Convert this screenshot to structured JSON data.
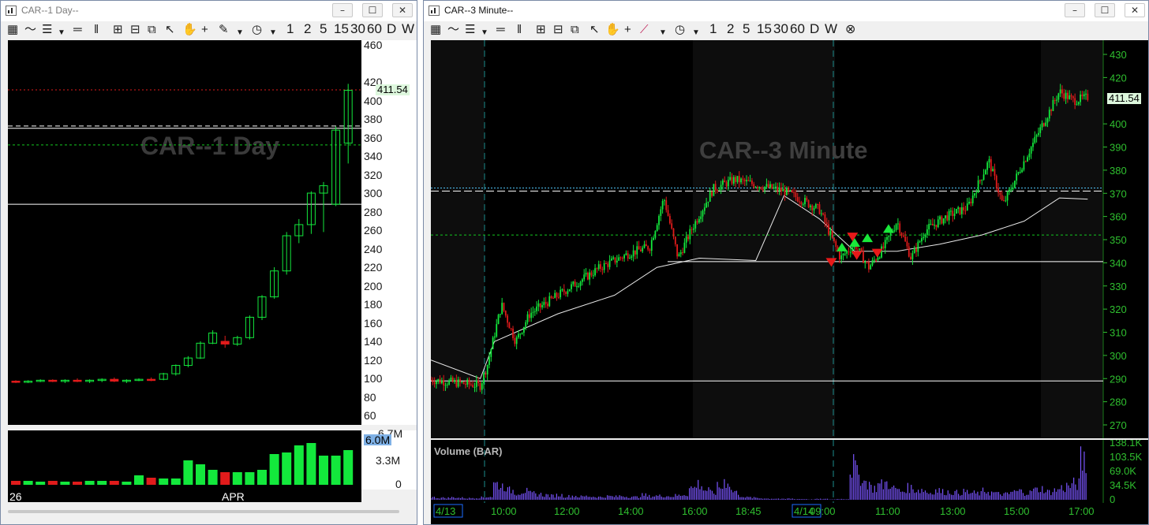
{
  "left_window": {
    "title": "CAR--1 Day--",
    "watermark": "CAR--1 Day",
    "last_price": "411.54",
    "volume_tag": "6.0M",
    "price_ticks": [
      "460",
      "420",
      "400",
      "380",
      "360",
      "340",
      "320",
      "300",
      "280",
      "260",
      "240",
      "220",
      "200",
      "180",
      "160",
      "140",
      "120",
      "100",
      "80",
      "60"
    ],
    "volume_ticks": [
      "6.7M",
      "3.3M",
      "0"
    ],
    "date_labels": [
      "26",
      "APR"
    ]
  },
  "right_window": {
    "title": "CAR--3 Minute--",
    "watermark": "CAR--3 Minute",
    "last_price": "411.54",
    "volume_panel_label": "Volume (BAR)",
    "price_ticks": [
      "430",
      "420",
      "400",
      "390",
      "380",
      "370",
      "360",
      "350",
      "340",
      "330",
      "320",
      "310",
      "300",
      "290",
      "280",
      "270"
    ],
    "volume_ticks": [
      "138.1K",
      "103.5K",
      "69.0K",
      "34.5K",
      "0"
    ],
    "time_labels": [
      "4/13",
      "10:00",
      "12:00",
      "14:00",
      "16:00",
      "18:45",
      "4/14",
      "09:00",
      "11:00",
      "13:00",
      "15:00",
      "17:00"
    ]
  },
  "toolbar": {
    "intervals": [
      "1",
      "2",
      "5",
      "15",
      "30",
      "60",
      "D",
      "W"
    ]
  },
  "window_buttons": {
    "minimize": "–",
    "maximize": "☐",
    "close": "✕"
  },
  "colors": {
    "up": "#13e83c",
    "down": "#e11b1b",
    "volume_left": "#13e83c",
    "volume_right": "#7a55ff",
    "axis_green": "#2fbf2f",
    "vwap": "#ffffff",
    "level_dashed": "#ffffff",
    "level_green": "#13c81f",
    "level_red": "#e11b1b",
    "level_cyan": "#4fc3f7"
  },
  "chart_data": [
    {
      "type": "candlestick",
      "title": "CAR--1 Day",
      "ylim": [
        60,
        460
      ],
      "ohlc": [
        [
          97,
          98,
          95,
          96
        ],
        [
          96,
          98,
          95,
          97
        ],
        [
          97,
          99,
          96,
          98
        ],
        [
          98,
          99,
          96,
          97
        ],
        [
          97,
          99,
          95,
          98
        ],
        [
          98,
          100,
          96,
          97
        ],
        [
          97,
          99,
          95,
          98
        ],
        [
          98,
          100,
          96,
          99
        ],
        [
          99,
          101,
          96,
          97
        ],
        [
          97,
          99,
          95,
          98
        ],
        [
          98,
          100,
          97,
          99
        ],
        [
          99,
          101,
          97,
          98
        ],
        [
          99,
          106,
          98,
          105
        ],
        [
          105,
          115,
          103,
          114
        ],
        [
          114,
          124,
          112,
          122
        ],
        [
          122,
          140,
          121,
          138
        ],
        [
          138,
          152,
          137,
          149
        ],
        [
          140,
          146,
          133,
          137
        ],
        [
          137,
          146,
          135,
          144
        ],
        [
          144,
          168,
          142,
          166
        ],
        [
          166,
          190,
          163,
          188
        ],
        [
          188,
          220,
          186,
          216
        ],
        [
          216,
          258,
          212,
          254
        ],
        [
          254,
          272,
          246,
          266
        ],
        [
          266,
          302,
          256,
          300
        ],
        [
          300,
          312,
          258,
          308
        ],
        [
          288,
          372,
          286,
          368
        ],
        [
          354,
          418,
          332,
          411
        ]
      ],
      "volume_millions": [
        0.5,
        0.5,
        0.4,
        0.5,
        0.4,
        0.4,
        0.5,
        0.5,
        0.5,
        0.4,
        1.2,
        0.9,
        0.8,
        0.8,
        3.1,
        2.6,
        1.9,
        1.6,
        1.6,
        1.6,
        1.9,
        3.9,
        4.1,
        5.0,
        5.3,
        3.7,
        3.7,
        4.4
      ]
    },
    {
      "type": "candlestick",
      "title": "CAR--3 Minute",
      "ylim": [
        265,
        433
      ],
      "levels": [
        289,
        340.5,
        352,
        370.5,
        372
      ],
      "price_path": [
        [
          0,
          289.5
        ],
        [
          0.07,
          287
        ],
        [
          0.08,
          296
        ],
        [
          0.1,
          322
        ],
        [
          0.12,
          306
        ],
        [
          0.14,
          318
        ],
        [
          0.16,
          322
        ],
        [
          0.2,
          330
        ],
        [
          0.24,
          338
        ],
        [
          0.28,
          344
        ],
        [
          0.31,
          347
        ],
        [
          0.33,
          368
        ],
        [
          0.35,
          342
        ],
        [
          0.37,
          355
        ],
        [
          0.4,
          372
        ],
        [
          0.43,
          376
        ],
        [
          0.47,
          373
        ],
        [
          0.5,
          371
        ],
        [
          0.52,
          368
        ],
        [
          0.55,
          363
        ],
        [
          0.58,
          342
        ],
        [
          0.6,
          348
        ],
        [
          0.62,
          338
        ],
        [
          0.64,
          346
        ],
        [
          0.66,
          358
        ],
        [
          0.68,
          342
        ],
        [
          0.7,
          354
        ],
        [
          0.73,
          360
        ],
        [
          0.76,
          364
        ],
        [
          0.79,
          384
        ],
        [
          0.81,
          365
        ],
        [
          0.84,
          384
        ],
        [
          0.87,
          402
        ],
        [
          0.89,
          414
        ],
        [
          0.91,
          410
        ],
        [
          0.93,
          411.5
        ]
      ],
      "vwap_path": [
        [
          0,
          298
        ],
        [
          0.07,
          290
        ],
        [
          0.09,
          306
        ],
        [
          0.18,
          318
        ],
        [
          0.26,
          326
        ],
        [
          0.32,
          338
        ],
        [
          0.38,
          342
        ],
        [
          0.46,
          341
        ],
        [
          0.5,
          369
        ],
        [
          0.55,
          359
        ],
        [
          0.6,
          345
        ],
        [
          0.66,
          345
        ],
        [
          0.72,
          348
        ],
        [
          0.78,
          352
        ],
        [
          0.84,
          358
        ],
        [
          0.89,
          368
        ],
        [
          0.93,
          367.5
        ]
      ],
      "volume_thousands": [
        6,
        5,
        5,
        6,
        5,
        4,
        5,
        6,
        8,
        40,
        35,
        24,
        18,
        22,
        16,
        14,
        12,
        10,
        12,
        9,
        10,
        8,
        9,
        8,
        7,
        9,
        8,
        10,
        8,
        7,
        12,
        9,
        10,
        10,
        9,
        11,
        14,
        30,
        40,
        25,
        18,
        32,
        48,
        22,
        10,
        6,
        5,
        4,
        3,
        3,
        2,
        3,
        2,
        2,
        1,
        2,
        2,
        1,
        2,
        2,
        85,
        62,
        45,
        30,
        38,
        42,
        28,
        22,
        30,
        26,
        25,
        18,
        24,
        20,
        20,
        18,
        20,
        17,
        16,
        22,
        18,
        15,
        14,
        20,
        22,
        18,
        25,
        28,
        20,
        24,
        30,
        35,
        40,
        98
      ]
    }
  ]
}
